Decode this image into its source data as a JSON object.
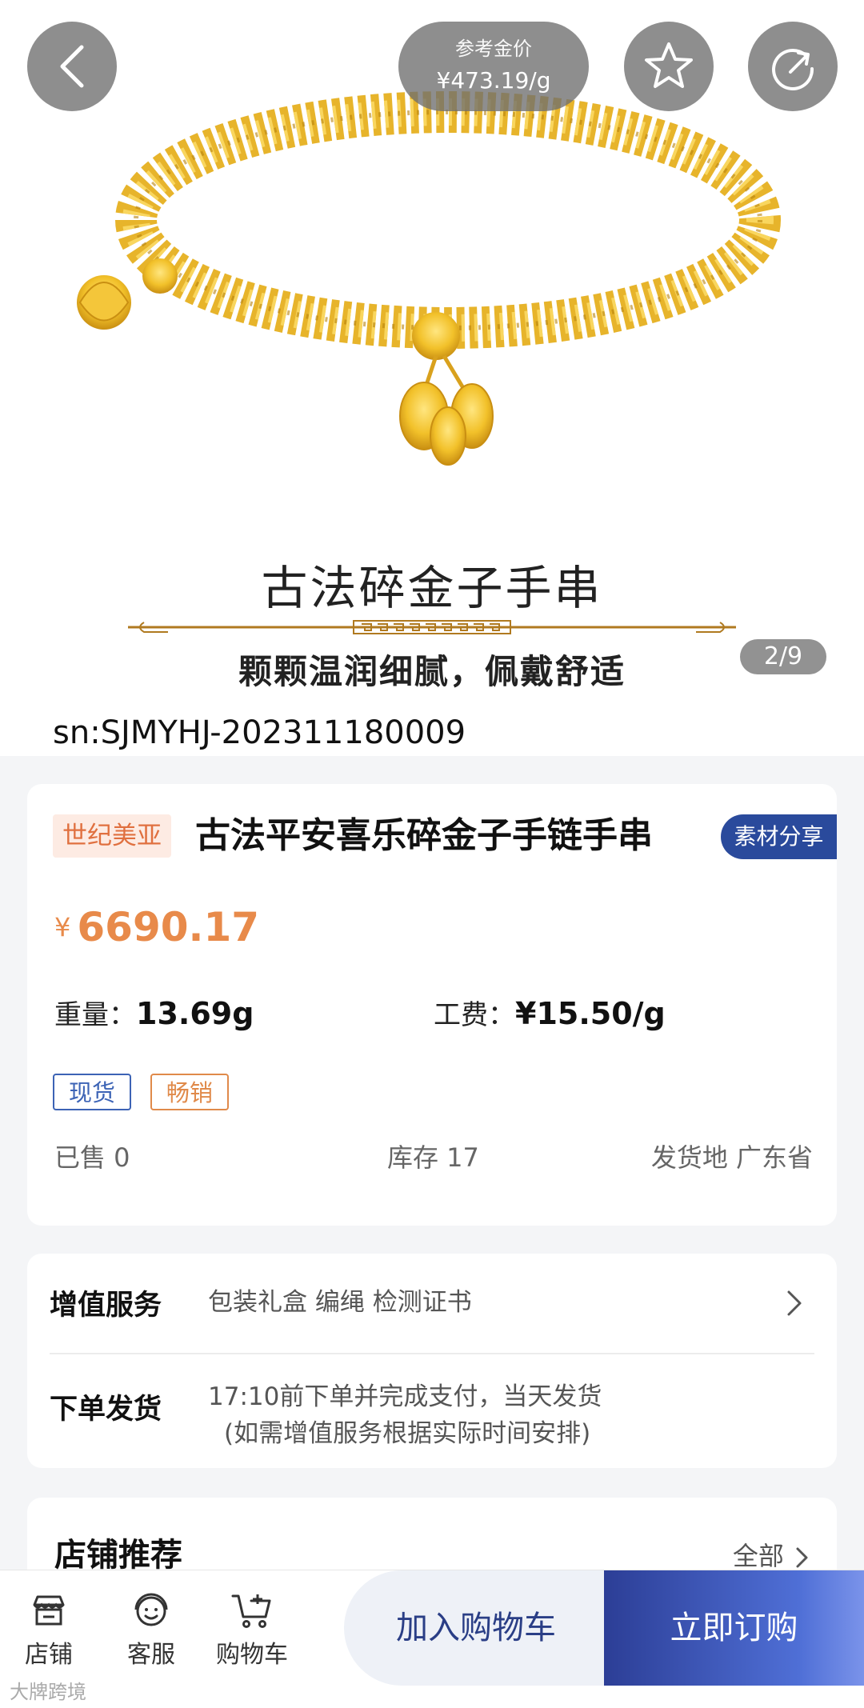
{
  "header": {
    "ref_price_label": "参考金价",
    "ref_price_value": "¥473.19/g"
  },
  "gallery": {
    "banner_title": "古法碎金子手串",
    "banner_subtitle": "颗颗温润细腻，佩戴舒适",
    "page_indicator": "2/9",
    "sn": "sn:SJMYHJ-202311180009"
  },
  "product": {
    "brand": "世纪美亚",
    "title": "古法平安喜乐碎金子手链手串",
    "share_label": "素材分享",
    "currency": "¥",
    "price": "6690.17",
    "weight_label": "重量：",
    "weight_value": "13.69g",
    "fee_label": "工费：",
    "fee_value": "¥15.50/g",
    "tags": [
      "现货",
      "畅销"
    ],
    "sold": "已售 0",
    "stock": "库存 17",
    "ship_from": "发货地 广东省"
  },
  "services": {
    "value_added_label": "增值服务",
    "value_added_text": "包装礼盒 编绳 检测证书",
    "order_label": "下单发货",
    "order_text_line1": "17:10前下单并完成支付，当天发货",
    "order_text_line2": "(如需增值服务根据实际时间安排)"
  },
  "recommend": {
    "title": "店铺推荐",
    "all_label": "全部"
  },
  "bottom_bar": {
    "store": "店铺",
    "service": "客服",
    "cart": "购物车",
    "add_to_cart": "加入购物车",
    "buy_now": "立即订购"
  },
  "watermark": "大牌跨境",
  "colors": {
    "accent_price": "#e88a4a",
    "brand_blue": "#2a4a9c",
    "gold": "#e8b422"
  }
}
